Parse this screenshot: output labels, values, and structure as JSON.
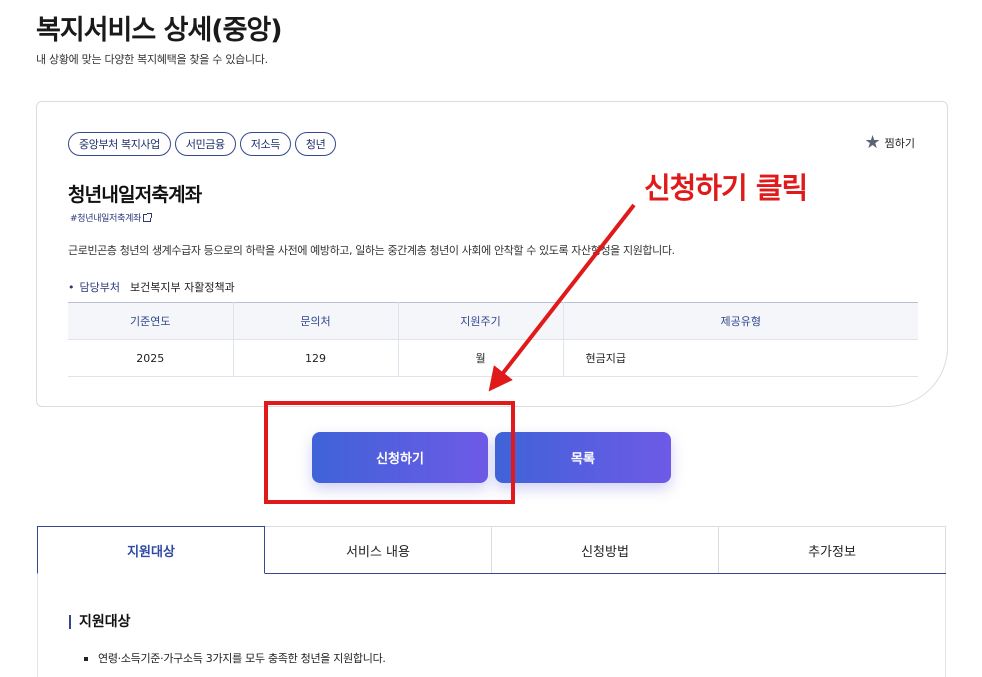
{
  "page": {
    "title": "복지서비스 상세(중앙)",
    "subtitle": "내 상황에 맞는 다양한 복지혜택을 찾을 수 있습니다."
  },
  "service": {
    "tags": [
      "중앙부처 복지사업",
      "서민금융",
      "저소득",
      "청년"
    ],
    "favorite_label": "찜하기",
    "title": "청년내일저축계좌",
    "link_text": "#청년내일저축계좌",
    "description": "근로빈곤층 청년의 생계수급자 등으로의 하락을 사전에 예방하고, 일하는 중간계층 청년이 사회에 안착할 수 있도록 자산형성을 지원합니다.",
    "department_label": "담당부처",
    "department_value": "보건복지부 자활정책과",
    "table": {
      "headers": [
        "기준연도",
        "문의처",
        "지원주기",
        "제공유형"
      ],
      "row": [
        "2025",
        "129",
        "월",
        "현금지급"
      ]
    }
  },
  "buttons": {
    "apply": "신청하기",
    "list": "목록"
  },
  "tabs": [
    "지원대상",
    "서비스 내용",
    "신청방법",
    "추가정보"
  ],
  "content": {
    "section_title": "지원대상",
    "items": [
      "연령·소득기준·가구소득 3가지를 모두 충족한 청년을 지원합니다."
    ]
  },
  "annotation": {
    "text": "신청하기 클릭",
    "color": "#e01a1a"
  },
  "colors": {
    "accent": "#33488f",
    "button_start": "#3f63d8",
    "button_end": "#6e5ae6"
  }
}
